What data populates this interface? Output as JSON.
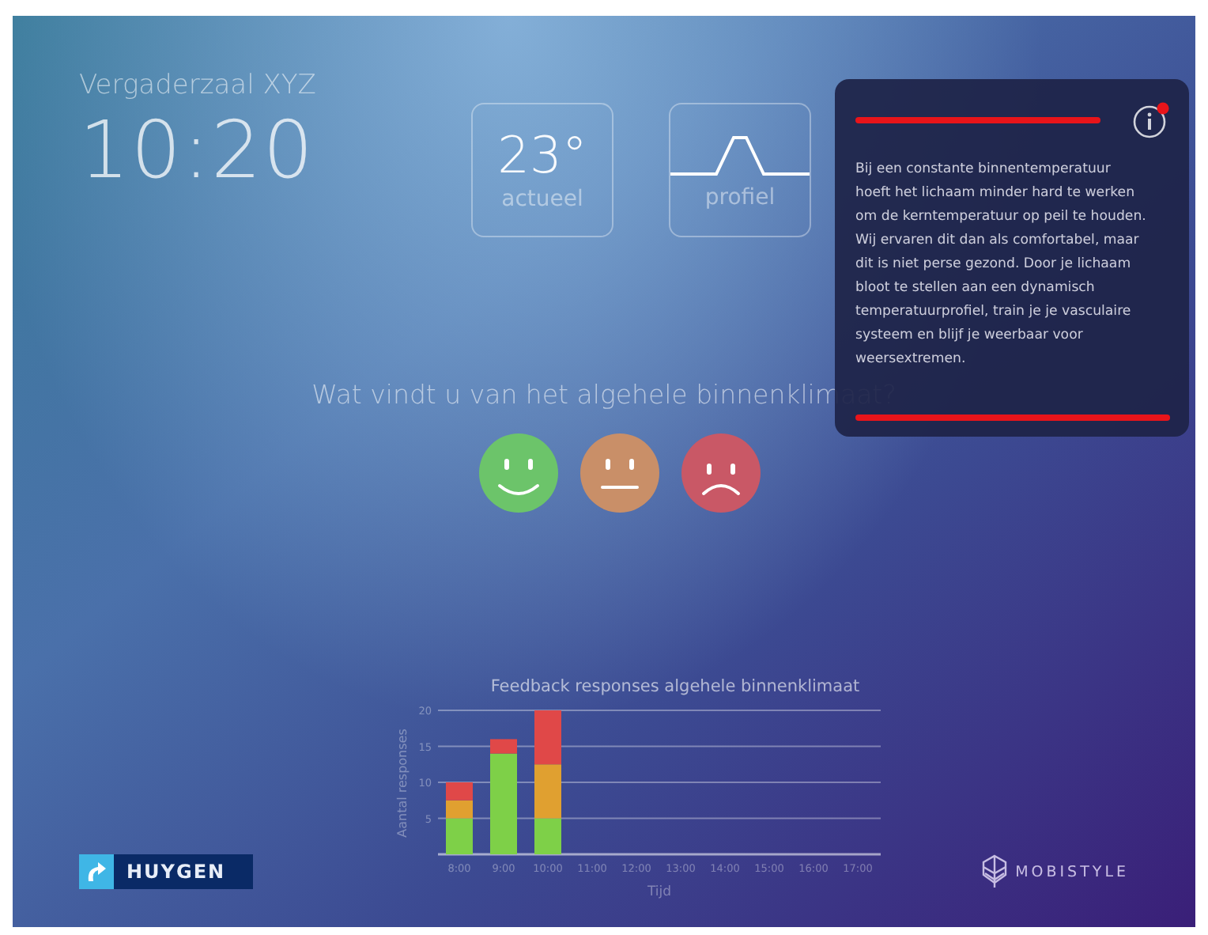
{
  "room": "Vergaderzaal XYZ",
  "time": "10:20",
  "tiles": [
    {
      "kind": "temperature",
      "value": "23°",
      "label": "actueel"
    },
    {
      "kind": "profile",
      "label": "profiel"
    }
  ],
  "info_panel": {
    "notification": true,
    "text": "Bij een constante binnentemperatuur hoeft het lichaam minder hard te werken om de kerntemperatuur op peil te houden. Wij ervaren dit dan als comfortabel, maar dit is niet perse gezond. Door je lichaam bloot te stellen aan een dynamisch temperatuurprofiel, train je je vasculaire systeem en blijf je weerbaar voor weersextremen."
  },
  "question": "Wat vindt u van het algehele binnenklimaat?",
  "ratings": [
    {
      "kind": "happy",
      "color": "#6cc46a"
    },
    {
      "kind": "neutral",
      "color": "#c98f68"
    },
    {
      "kind": "sad",
      "color": "#c95866"
    }
  ],
  "chart": {
    "chart_data": {
      "type": "bar",
      "stacked": true,
      "title": "Feedback responses algehele binnenklimaat",
      "xlabel": "Tijd",
      "ylabel": "Aantal responses",
      "categories": [
        "8:00",
        "9:00",
        "10:00",
        "11:00",
        "12:00",
        "13:00",
        "14:00",
        "15:00",
        "16:00",
        "17:00"
      ],
      "grid": true,
      "series": [
        {
          "color": "#7ed048",
          "values": [
            5,
            14,
            5,
            null,
            null,
            null,
            null,
            null,
            null,
            null
          ]
        },
        {
          "color": "#e0a030",
          "values": [
            2.5,
            0,
            7.5,
            null,
            null,
            null,
            null,
            null,
            null,
            null
          ]
        },
        {
          "color": "#e04848",
          "values": [
            2.5,
            2,
            7.5,
            null,
            null,
            null,
            null,
            null,
            null,
            null
          ]
        }
      ],
      "ylim": [
        0,
        20
      ],
      "yticks": [
        5,
        10,
        15,
        20
      ]
    }
  },
  "logos": {
    "left": "HUYGEN",
    "right": "MOBISTYLE"
  }
}
